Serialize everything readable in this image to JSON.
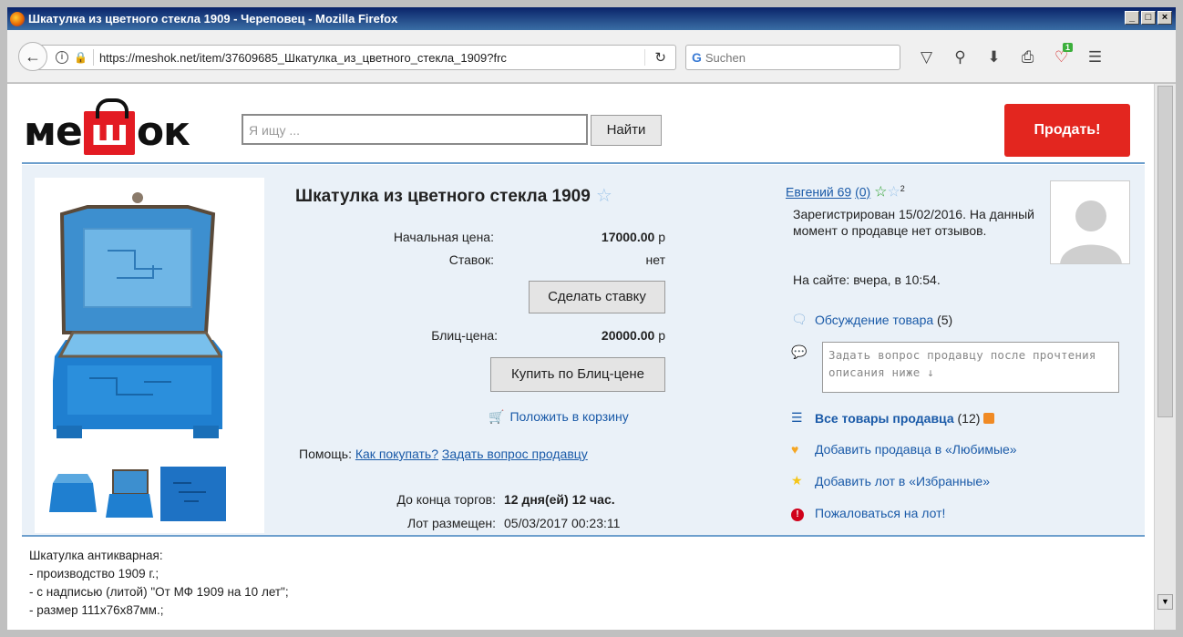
{
  "window": {
    "title": "Шкатулка из цветного стекла 1909 - Череповец - Mozilla Firefox",
    "controls": [
      "_",
      "□",
      "×"
    ]
  },
  "browser": {
    "url": "https://meshok.net/item/37609685_Шкатулка_из_цветного_стекла_1909?frc",
    "search_placeholder": "Suchen",
    "addon_badge": "1"
  },
  "site": {
    "logo_left": "ме",
    "logo_bag": "ш",
    "logo_right": "ок",
    "search_placeholder": "Я ищу ...",
    "search_button": "Найти",
    "sell_button": "Продать!"
  },
  "lot": {
    "title": "Шкатулка из цветного стекла 1909",
    "start_price_label": "Начальная цена:",
    "start_price_value": "17000.00",
    "currency": "р",
    "bids_label": "Ставок:",
    "bids_value": "нет",
    "bid_button": "Сделать ставку",
    "blitz_label": "Блиц-цена:",
    "blitz_value": "20000.00",
    "blitz_button": "Купить по Блиц-цене",
    "cart_link": "Положить в корзину",
    "help_label": "Помощь:",
    "help_link_1": "Как покупать?",
    "help_link_2": "Задать вопрос продавцу",
    "end_label": "До конца торгов:",
    "end_value": "12 дня(ей) 12 час.",
    "posted_label": "Лот размещен:",
    "posted_value": "05/03/2017 00:23:11"
  },
  "seller": {
    "name": "Евгений 69",
    "reviews": "(0)",
    "stars_count": "2",
    "registered": "Зарегистрирован 15/02/2016. На данный момент о продавце нет отзывов.",
    "online": "На сайте: вчера, в 10:54.",
    "discussion_link": "Обсуждение товара",
    "discussion_count": "(5)",
    "question_placeholder": "Задать вопрос продавцу после прочтения описания ниже ↓",
    "all_items_link": "Все товары продавца",
    "all_items_count": "(12)",
    "fav_seller_link": "Добавить продавца в «Любимые»",
    "fav_lot_link": "Добавить лот в «Избранные»",
    "report_link": "Пожаловаться на лот!"
  },
  "description": {
    "lines": [
      "Шкатулка антикварная:",
      "- производство 1909 г.;",
      "- с надписью (литой) \"От МФ 1909 на 10 лет\";",
      "- размер 111x76x87мм.;"
    ]
  },
  "colors": {
    "accent_red": "#e3261f",
    "link_blue": "#1a5aa8",
    "panel_bg": "#eaf1f8",
    "divider_blue": "#6d9fcd"
  }
}
